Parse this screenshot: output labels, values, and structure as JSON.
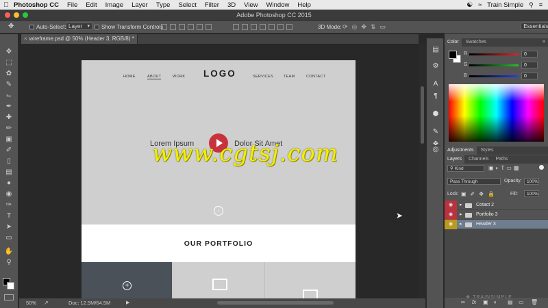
{
  "menubar": {
    "app_name": "Photoshop CC",
    "items": [
      "File",
      "Edit",
      "Image",
      "Layer",
      "Type",
      "Select",
      "Filter",
      "3D",
      "View",
      "Window",
      "Help"
    ],
    "user": "Train Simple"
  },
  "window": {
    "title": "Adobe Photoshop CC 2015"
  },
  "options_bar": {
    "auto_select_label": "Auto-Select:",
    "auto_select_target": "Layer",
    "show_transform_label": "Show Transform Controls",
    "mode_3d_label": "3D Mode:",
    "workspace": "Essentials"
  },
  "document": {
    "tab_label": "wireframe.psd @ 50% (Header 3, RGB/8) *"
  },
  "artboard": {
    "nav_left": [
      "HOME",
      "ABOUT",
      "WORK"
    ],
    "logo": "LOGO",
    "nav_right": [
      "SERVICES",
      "TEAM",
      "CONTACT"
    ],
    "hero_left": "Lorem Ipsum",
    "hero_right": "Dolor Sit Amet",
    "section_title": "OUR PORTFOLIO",
    "watermark": "www.cgtsj.com"
  },
  "status_bar": {
    "zoom": "50%",
    "doc_info": "Doc: 12.5M/64.5M"
  },
  "color_panel": {
    "tabs": [
      "Color",
      "Swatches"
    ],
    "channels": [
      {
        "label": "R",
        "value": "0",
        "color": "#e0242a"
      },
      {
        "label": "G",
        "value": "0",
        "color": "#27c22b"
      },
      {
        "label": "B",
        "value": "0",
        "color": "#2940e6"
      }
    ]
  },
  "adjustments_panel": {
    "tabs": [
      "Adjustments",
      "Styles"
    ]
  },
  "layers_panel": {
    "tabs": [
      "Layers",
      "Channels",
      "Paths"
    ],
    "filter_kind": "Kind",
    "blend_mode": "Pass Through",
    "opacity_label": "Opacity:",
    "opacity_value": "100%",
    "lock_label": "Lock:",
    "fill_label": "Fill:",
    "fill_value": "100%",
    "layers": [
      {
        "name": "Cotact 2",
        "eye_color": "#b8323f",
        "selected": false
      },
      {
        "name": "Portfolio 3",
        "eye_color": "#b8323f",
        "selected": false
      },
      {
        "name": "Header 3",
        "eye_color": "#b99a1c",
        "selected": true
      }
    ]
  },
  "branding": {
    "watermark_logo": "TRAINSIMPLE"
  }
}
